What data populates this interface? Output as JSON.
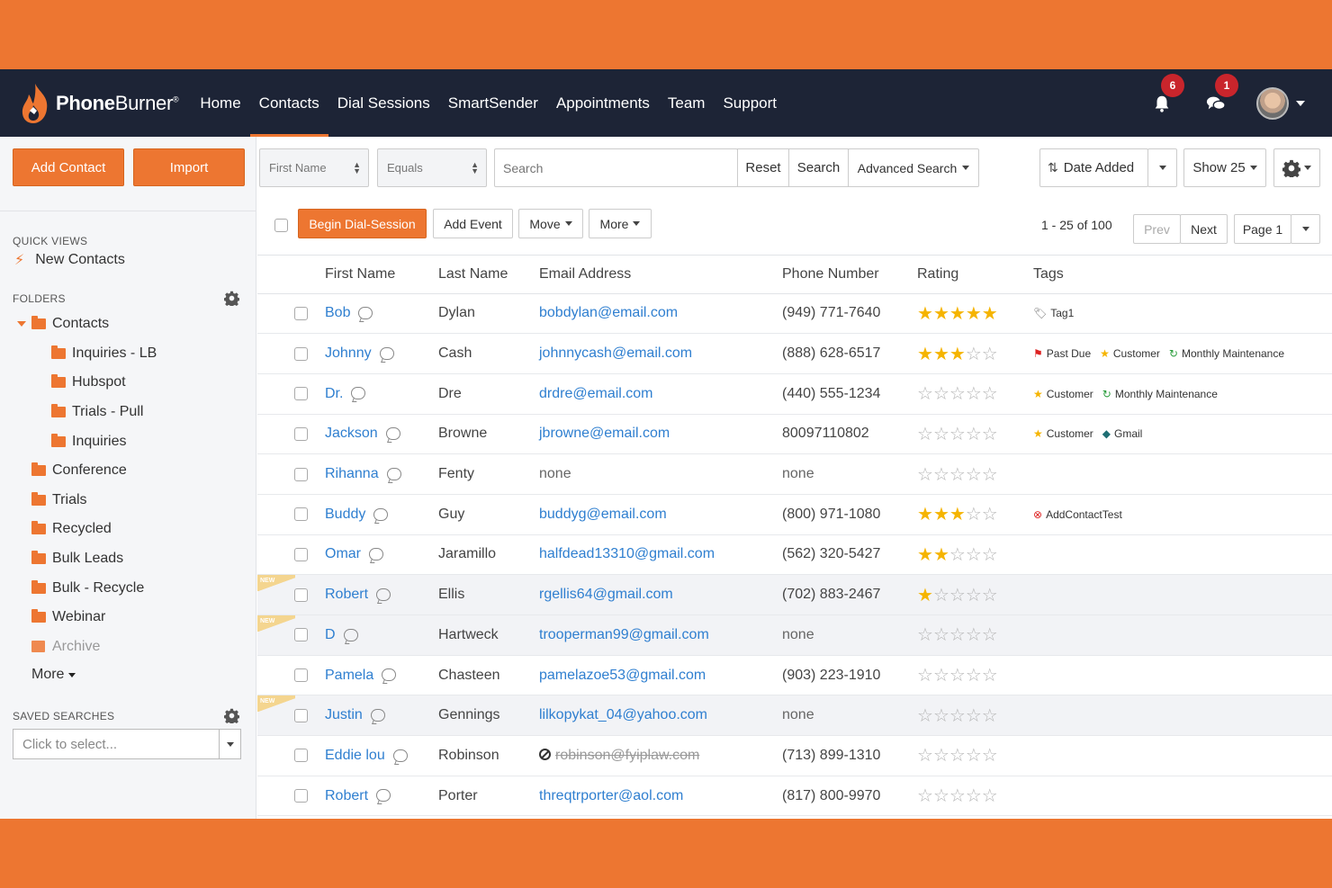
{
  "brand": {
    "name_bold": "Phone",
    "name_thin": "Burner",
    "mark": "®"
  },
  "nav": {
    "items": [
      {
        "label": "Home",
        "active": false
      },
      {
        "label": "Contacts",
        "active": true
      },
      {
        "label": "Dial Sessions",
        "active": false
      },
      {
        "label": "SmartSender",
        "active": false
      },
      {
        "label": "Appointments",
        "active": false
      },
      {
        "label": "Team",
        "active": false
      },
      {
        "label": "Support",
        "active": false
      }
    ],
    "notifications_count": "6",
    "messages_count": "1"
  },
  "sidebar": {
    "add_contact_label": "Add Contact",
    "import_label": "Import",
    "quick_views_title": "QUICK VIEWS",
    "new_contacts_label": "New Contacts",
    "folders_title": "FOLDERS",
    "folders": [
      {
        "label": "Contacts",
        "level": 0,
        "expanded": true
      },
      {
        "label": "Inquiries - LB",
        "level": 1
      },
      {
        "label": "Hubspot",
        "level": 1
      },
      {
        "label": "Trials - Pull",
        "level": 1
      },
      {
        "label": "Inquiries",
        "level": 1
      },
      {
        "label": "Conference",
        "level": 0
      },
      {
        "label": "Trials",
        "level": 0
      },
      {
        "label": "Recycled",
        "level": 0
      },
      {
        "label": "Bulk Leads",
        "level": 0
      },
      {
        "label": "Bulk - Recycle",
        "level": 0
      },
      {
        "label": "Webinar",
        "level": 0
      }
    ],
    "archive_label": "Archive",
    "more_label": "More",
    "saved_searches_title": "SAVED SEARCHES",
    "saved_searches_placeholder": "Click to select..."
  },
  "toolbar": {
    "field_select": "First Name",
    "operator_select": "Equals",
    "search_placeholder": "Search",
    "reset_label": "Reset",
    "search_label": "Search",
    "advanced_search_label": "Advanced Search",
    "sort_label": "Date Added",
    "show_label": "Show 25"
  },
  "actions": {
    "begin_dial_session_label": "Begin Dial-Session",
    "add_event_label": "Add Event",
    "move_label": "Move",
    "more_label": "More",
    "pagination_text": "1 - 25 of 100",
    "prev_label": "Prev",
    "next_label": "Next",
    "page_label": "Page 1"
  },
  "table": {
    "columns": [
      "First Name",
      "Last Name",
      "Email Address",
      "Phone Number",
      "Rating",
      "Tags"
    ],
    "new_label": "NEW",
    "rows": [
      {
        "first": "Bob",
        "last": "Dylan",
        "email": "bobdylan@email.com",
        "email_state": "link",
        "phone": "(949) 771-7640",
        "rating": 5,
        "is_new": false,
        "tags": [
          {
            "icon": "tag",
            "label": "Tag1"
          }
        ]
      },
      {
        "first": "Johnny",
        "last": "Cash",
        "email": "johnnycash@email.com",
        "email_state": "link",
        "phone": "(888) 628-6517",
        "rating": 3,
        "is_new": false,
        "tags": [
          {
            "icon": "flag",
            "label": "Past Due"
          },
          {
            "icon": "star",
            "label": "Customer"
          },
          {
            "icon": "refresh",
            "label": "Monthly Maintenance"
          }
        ]
      },
      {
        "first": "Dr.",
        "last": "Dre",
        "email": "drdre@email.com",
        "email_state": "link",
        "phone": "(440) 555-1234",
        "rating": 0,
        "is_new": false,
        "tags": [
          {
            "icon": "star",
            "label": "Customer"
          },
          {
            "icon": "refresh",
            "label": "Monthly Maintenance"
          }
        ]
      },
      {
        "first": "Jackson",
        "last": "Browne",
        "email": "jbrowne@email.com",
        "email_state": "link",
        "phone": "80097110802",
        "rating": 0,
        "is_new": false,
        "tags": [
          {
            "icon": "star",
            "label": "Customer"
          },
          {
            "icon": "tag-teal",
            "label": "Gmail"
          }
        ]
      },
      {
        "first": "Rihanna",
        "last": "Fenty",
        "email": "none",
        "email_state": "none",
        "phone": "none",
        "rating": 0,
        "is_new": false,
        "tags": []
      },
      {
        "first": "Buddy",
        "last": "Guy",
        "email": "buddyg@email.com",
        "email_state": "link",
        "phone": "(800) 971-1080",
        "rating": 3,
        "is_new": false,
        "tags": [
          {
            "icon": "circle-x",
            "label": "AddContactTest"
          }
        ]
      },
      {
        "first": "Omar",
        "last": "Jaramillo",
        "email": "halfdead13310@gmail.com",
        "email_state": "link",
        "phone": "(562) 320-5427",
        "rating": 2,
        "is_new": false,
        "tags": []
      },
      {
        "first": "Robert",
        "last": "Ellis",
        "email": "rgellis64@gmail.com",
        "email_state": "link",
        "phone": "(702) 883-2467",
        "rating": 1,
        "is_new": true,
        "tags": []
      },
      {
        "first": "D",
        "last": "Hartweck",
        "email": "trooperman99@gmail.com",
        "email_state": "link",
        "phone": "none",
        "rating": 0,
        "is_new": true,
        "tags": []
      },
      {
        "first": "Pamela",
        "last": "Chasteen",
        "email": "pamelazoe53@gmail.com",
        "email_state": "link",
        "phone": "(903) 223-1910",
        "rating": 0,
        "is_new": false,
        "tags": []
      },
      {
        "first": "Justin",
        "last": "Gennings",
        "email": "lilkopykat_04@yahoo.com",
        "email_state": "link",
        "phone": "none",
        "rating": 0,
        "is_new": true,
        "tags": []
      },
      {
        "first": "Eddie lou",
        "last": "Robinson",
        "email": "robinson@fyiplaw.com",
        "email_state": "blocked",
        "phone": "(713) 899-1310",
        "rating": 0,
        "is_new": false,
        "tags": []
      },
      {
        "first": "Robert",
        "last": "Porter",
        "email": "threqtrporter@aol.com",
        "email_state": "link",
        "phone": "(817) 800-9970",
        "rating": 0,
        "is_new": false,
        "tags": []
      }
    ]
  },
  "colors": {
    "brand_orange": "#ed7631",
    "nav_bg": "#1d2436",
    "link_blue": "#2f7fd0",
    "star_gold": "#f5b400",
    "badge_red": "#c9252c"
  }
}
